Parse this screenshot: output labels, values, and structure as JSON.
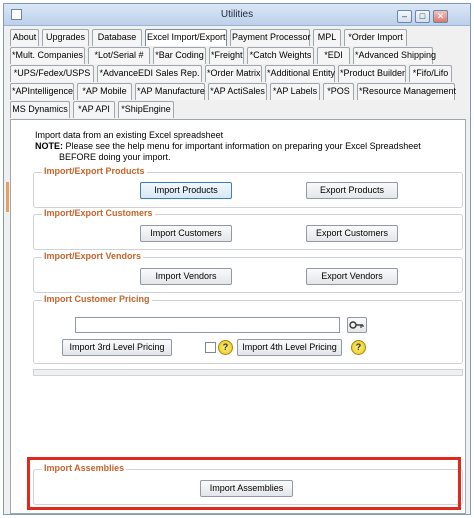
{
  "window": {
    "title": "Utilities",
    "controls": {
      "minimize": "–",
      "maximize": "□",
      "close": "✕"
    }
  },
  "tabs": {
    "row1": [
      "About",
      "Upgrades",
      "Database",
      "Excel Import/Export",
      "Payment Processor",
      "MPL",
      "*Order Import"
    ],
    "row2": [
      "*Mult. Companies",
      "*Lot/Serial #",
      "*Bar Coding",
      "*Freight",
      "*Catch Weights",
      "*EDI",
      "*Advanced Shipping"
    ],
    "row3": [
      "*UPS/Fedex/USPS",
      "*AdvanceEDI Sales Rep.",
      "*Order Matrix",
      "*Additional Entity",
      "*Product Builder",
      "*Fifo/Lifo"
    ],
    "row4": [
      "*APIntelligence",
      "*AP Mobile",
      "*AP Manufacture",
      "*AP ActiSales",
      "*AP Labels",
      "*POS",
      "*Resource Management"
    ],
    "row5": [
      "MS Dynamics",
      "*AP API",
      "*ShipEngine"
    ],
    "selected": "Excel Import/Export"
  },
  "intro": {
    "line1": "Import data from an existing Excel spreadsheet",
    "note_label": "NOTE:",
    "note_text": " Please see the help menu for important information on preparing your Excel Spreadsheet",
    "line3": "BEFORE doing your import."
  },
  "groups": {
    "products": {
      "title": "Import/Export Products",
      "import": "Import Products",
      "export": "Export Products"
    },
    "customers": {
      "title": "Import/Export Customers",
      "import": "Import Customers",
      "export": "Export Customers"
    },
    "vendors": {
      "title": "Import/Export Vendors",
      "import": "Import Vendors",
      "export": "Export Vendors"
    },
    "pricing": {
      "title": "Import Customer Pricing",
      "file_value": "",
      "level3": "Import 3rd Level Pricing",
      "level4": "Import 4th Level Pricing",
      "help": "?"
    },
    "assemblies": {
      "title": "Import Assemblies",
      "import": "Import Assemblies"
    }
  }
}
